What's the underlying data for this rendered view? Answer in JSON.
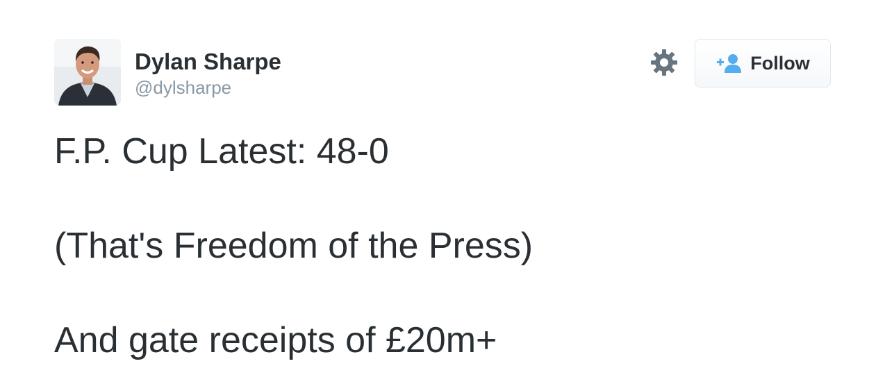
{
  "user": {
    "display_name": "Dylan Sharpe",
    "handle": "@dylsharpe",
    "avatar_alt": "avatar"
  },
  "actions": {
    "gear_icon": "gear-icon",
    "follow_icon": "add-user-icon",
    "follow_label": "Follow"
  },
  "tweet": {
    "lines": [
      "F.P. Cup Latest: 48-0",
      "(That's Freedom of the Press)",
      "And gate receipts of £20m+"
    ]
  },
  "colors": {
    "text": "#292f33",
    "handle": "#8899a6",
    "follow_icon": "#55acee",
    "gear": "#66757f",
    "button_border": "#e1e8ed"
  }
}
